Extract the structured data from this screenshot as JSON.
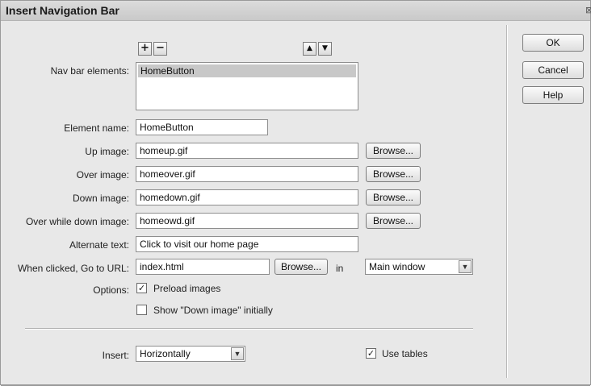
{
  "window": {
    "title": "Insert Navigation Bar",
    "close_glyph": "⊠"
  },
  "toolbar": {
    "add_glyph": "+",
    "remove_glyph": "−",
    "up_glyph": "▲",
    "down_glyph": "▼"
  },
  "nav_bar": {
    "label": "Nav bar elements:",
    "items": [
      "HomeButton"
    ]
  },
  "element_name": {
    "label": "Element name:",
    "value": "HomeButton"
  },
  "up_image": {
    "label": "Up image:",
    "value": "homeup.gif",
    "browse": "Browse..."
  },
  "over_image": {
    "label": "Over image:",
    "value": "homeover.gif",
    "browse": "Browse..."
  },
  "down_image": {
    "label": "Down image:",
    "value": "homedown.gif",
    "browse": "Browse..."
  },
  "over_while_down_image": {
    "label": "Over while down image:",
    "value": "homeowd.gif",
    "browse": "Browse..."
  },
  "alternate_text": {
    "label": "Alternate text:",
    "value": "Click to visit our home page"
  },
  "url": {
    "label": "When clicked, Go to URL:",
    "value": "index.html",
    "browse": "Browse...",
    "in_label": "in",
    "target": "Main window"
  },
  "options": {
    "label": "Options:",
    "preload_label": "Preload images",
    "preload_checked": true,
    "show_down_label": "Show \"Down image\" initially",
    "show_down_checked": false
  },
  "insert": {
    "label": "Insert:",
    "value": "Horizontally"
  },
  "use_tables": {
    "label": "Use tables",
    "checked": true
  },
  "buttons": {
    "ok": "OK",
    "cancel": "Cancel",
    "help": "Help"
  },
  "icons": {
    "dropdown_arrow": "▼",
    "check_mark": "✓"
  }
}
